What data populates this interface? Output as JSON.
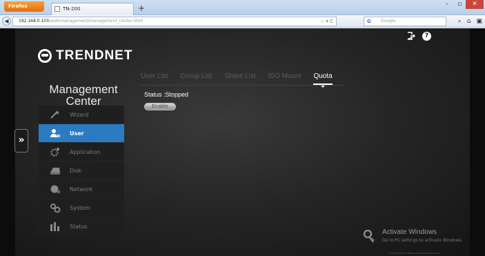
{
  "browser": {
    "menu_button": "Firefox",
    "tab_title": "TN-200",
    "new_tab": "+",
    "url_host": "192.168.0.103",
    "url_path": "/web/management/management_center.html",
    "url_controls": "☆ ▾ C",
    "search_placeholder": "Google",
    "search_engine_icon": "G"
  },
  "header": {
    "logo_text": "TRENDNET",
    "title": "Management Center",
    "help_glyph": "?"
  },
  "sidebar": {
    "items": [
      {
        "label": "Wizard",
        "icon": "wizard-icon",
        "active": false
      },
      {
        "label": "User",
        "icon": "user-icon",
        "active": true
      },
      {
        "label": "Application",
        "icon": "application-icon",
        "active": false
      },
      {
        "label": "Disk",
        "icon": "disk-icon",
        "active": false
      },
      {
        "label": "Network",
        "icon": "network-icon",
        "active": false
      },
      {
        "label": "System",
        "icon": "system-icon",
        "active": false
      },
      {
        "label": "Status",
        "icon": "status-icon",
        "active": false
      }
    ]
  },
  "tabs": [
    {
      "label": "User List",
      "active": false
    },
    {
      "label": "Group List",
      "active": false
    },
    {
      "label": "Share List",
      "active": false
    },
    {
      "label": "ISO Mount",
      "active": false
    },
    {
      "label": "Quota",
      "active": true
    }
  ],
  "main": {
    "status_text": "Status :Stopped",
    "enable_button": "Enable"
  },
  "expander_glyph": "»",
  "watermark": {
    "title": "Activate Windows",
    "subtitle": "Go to PC settings to activate Windows."
  },
  "copyright": "Copyright©2013 TRENDnet. All Rights Reserved.",
  "colors": {
    "active_item": "#2b7bc2",
    "background": "#262626"
  }
}
